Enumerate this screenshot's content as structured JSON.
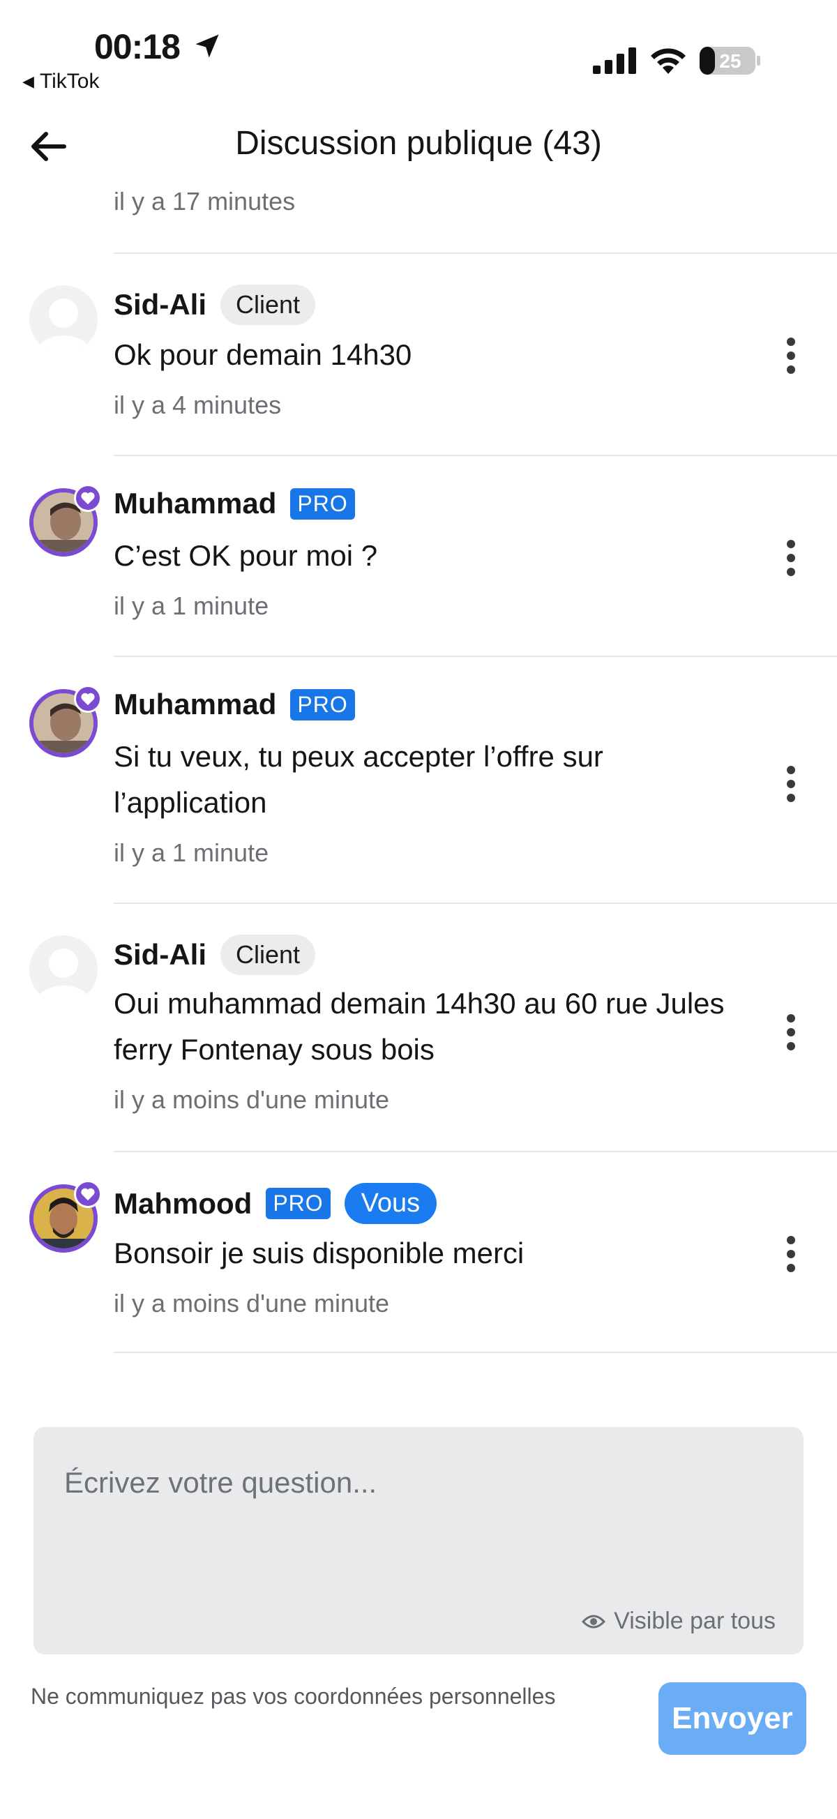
{
  "status_bar": {
    "time": "00:18",
    "back_app": "TikTok",
    "battery": "25"
  },
  "header": {
    "title": "Discussion publique (43)"
  },
  "first_comment_time": "il y a 17 minutes",
  "comments": [
    {
      "name": "Sid-Ali",
      "tag": "Client",
      "text": "Ok pour demain 14h30",
      "time": "il y a 4 minutes"
    },
    {
      "name": "Muhammad",
      "tag": "PRO",
      "text": "C’est OK pour moi ?",
      "time": "il y a 1 minute"
    },
    {
      "name": "Muhammad",
      "tag": "PRO",
      "text": "Si tu veux, tu peux accepter l’offre sur l’application",
      "time": "il y a 1 minute"
    },
    {
      "name": "Sid-Ali",
      "tag": "Client",
      "text": "Oui muhammad demain 14h30 au 60 rue Jules ferry Fontenay sous bois",
      "time": "il y a moins d'une minute"
    },
    {
      "name": "Mahmood",
      "tag": "PRO",
      "tag2": "Vous",
      "text": "Bonsoir je suis disponible merci",
      "time": "il y a moins d'une minute"
    }
  ],
  "composer": {
    "placeholder": "Écrivez votre question...",
    "visibility": "Visible par tous",
    "disclaimer": "Ne communiquez pas vos coordonnées personnelles",
    "send_label": "Envoyer"
  },
  "colors": {
    "accent_purple": "#7b4ad2",
    "pro_blue": "#1976e8",
    "send_disabled": "#6aadf5"
  },
  "icons": [
    "location-arrow-icon",
    "signal-icon",
    "wifi-icon",
    "battery-icon",
    "back-arrow-icon",
    "more-vertical-icon",
    "heart-icon",
    "eye-icon"
  ]
}
